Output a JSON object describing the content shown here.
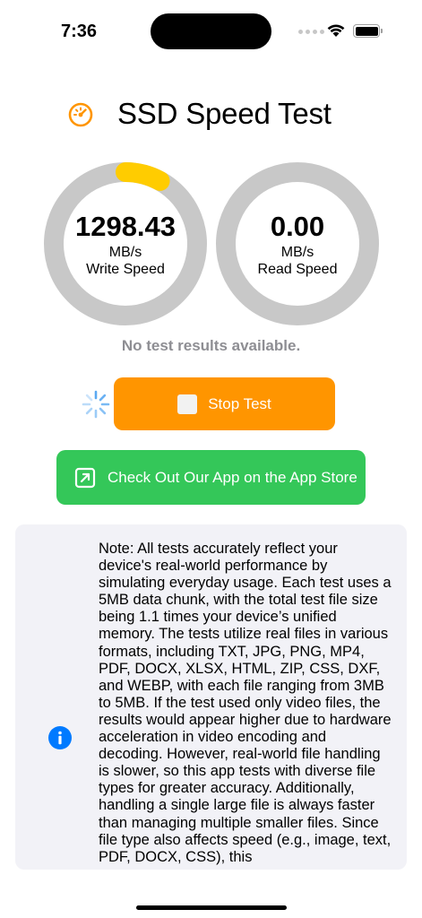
{
  "status_bar": {
    "time": "7:36"
  },
  "header": {
    "title": "SSD Speed Test",
    "icon": "speedometer-icon"
  },
  "write_gauge": {
    "value": "1298.43",
    "unit": "MB/s",
    "label": "Write Speed",
    "progress": 0.08,
    "color": "#ffcc00"
  },
  "read_gauge": {
    "value": "0.00",
    "unit": "MB/s",
    "label": "Read Speed",
    "progress": 0
  },
  "status_text": "No test results available.",
  "stop_button": {
    "label": "Stop Test",
    "color": "#ff9500",
    "icon": "stop-icon"
  },
  "appstore_button": {
    "label": "Check Out Our App on the App Store",
    "color": "#34c759",
    "icon": "external-link-icon"
  },
  "note": {
    "icon": "info-icon",
    "text": "Note: All tests accurately reflect your device's real-world performance by simulating everyday usage. Each test uses a 5MB data chunk, with the total test file size being 1.1 times your device’s unified memory. The tests utilize real files in various formats, including TXT, JPG, PNG, MP4, PDF, DOCX, XLSX, HTML, ZIP, CSS, DXF, and WEBP, with each file ranging from 3MB to 5MB. If the test used only video files, the results would appear higher due to hardware acceleration in video encoding and decoding. However, real-world file handling is slower, so this app tests with diverse file types for greater accuracy. Additionally, handling a single large file is always faster than managing multiple smaller files. Since file type also affects speed (e.g., image, text, PDF, DOCX, CSS), this"
  },
  "colors": {
    "ring_track": "#c8c8c8",
    "accent_orange": "#ff9500",
    "info_blue": "#007aff",
    "card_bg": "#f2f2f7"
  }
}
